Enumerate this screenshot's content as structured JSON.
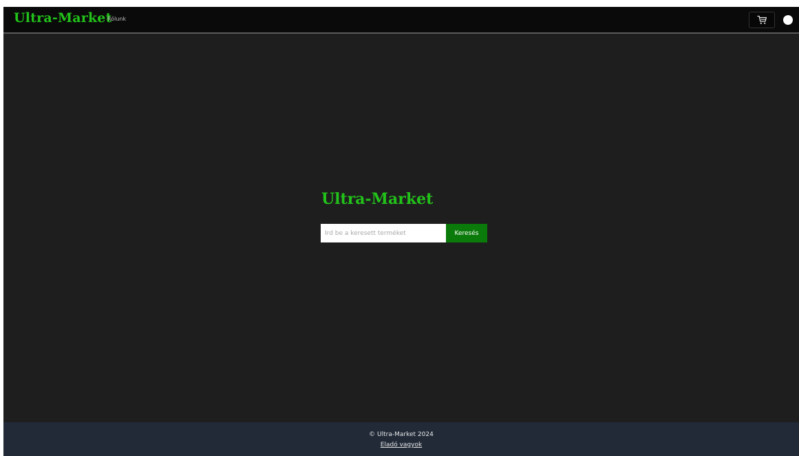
{
  "navbar": {
    "brand": "Ultra-Market",
    "links": [
      {
        "label": "Rólunk"
      }
    ],
    "cart_icon": "cart-icon",
    "theme_toggle_icon": "circle-toggle-icon"
  },
  "hero": {
    "title": "Ultra-Market"
  },
  "search": {
    "placeholder": "Írd be a keresett terméket",
    "value": "",
    "button_label": "Keresés"
  },
  "footer": {
    "copyright": "© Ultra-Market 2024",
    "seller_link": "Eladó vagyok"
  },
  "colors": {
    "brand_green": "#22c21a",
    "button_green": "#0a7a0a",
    "background": "#1e1e1e",
    "navbar_bg": "#0a0a0a",
    "footer_bg": "#222a38"
  }
}
